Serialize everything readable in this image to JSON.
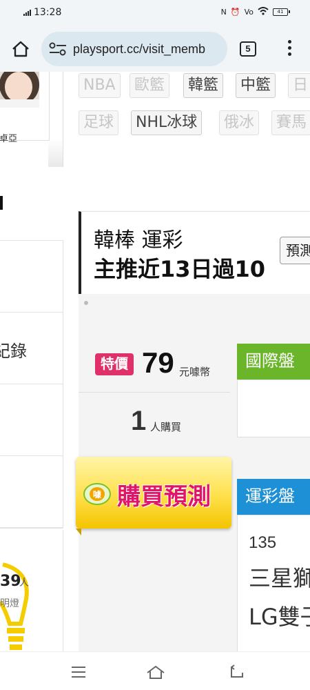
{
  "status_bar": {
    "time": "13:28",
    "battery": "41"
  },
  "browser": {
    "url": "playsport.cc/visit_memb",
    "tab_count": "5"
  },
  "sidebar": {
    "profile_name": "卓亞",
    "menu_items": [
      {
        "label": ""
      },
      {
        "label": "紀錄"
      },
      {
        "label": ""
      },
      {
        "label": ""
      }
    ],
    "lamp_count": "39",
    "lamp_unit": "人",
    "lamp_caption": "明燈"
  },
  "league_filters": {
    "row1": [
      {
        "label": "NBA",
        "active": false
      },
      {
        "label": "歐籃",
        "active": false
      },
      {
        "label": "韓籃",
        "active": true
      },
      {
        "label": "中籃",
        "active": true
      },
      {
        "label": "日",
        "active": false
      }
    ],
    "row2": [
      {
        "label": "足球",
        "active": false
      },
      {
        "label": "NHL冰球",
        "active": true
      },
      {
        "label": "俄冰",
        "active": false
      },
      {
        "label": "賽馬",
        "active": false
      }
    ]
  },
  "prediction": {
    "title": "韓棒 運彩",
    "record": "主推近13日過10",
    "button": "預測"
  },
  "offer": {
    "tag": "特價",
    "price": "79",
    "price_unit": "元噱幣",
    "buyers": "1",
    "buyers_unit": "人購買",
    "buy_button": "購買預測",
    "icon_text": "噱"
  },
  "markets": {
    "international": {
      "label": "國際盤"
    },
    "sports_lottery": {
      "label": "運彩盤",
      "game_no": "135",
      "teams": [
        "三星獅",
        "LG雙子"
      ]
    }
  },
  "colors": {
    "international_header": "#6ab52a",
    "lottery_header": "#1d90d6",
    "price_tag": "#e0306a",
    "buy_text": "#e0156a"
  }
}
